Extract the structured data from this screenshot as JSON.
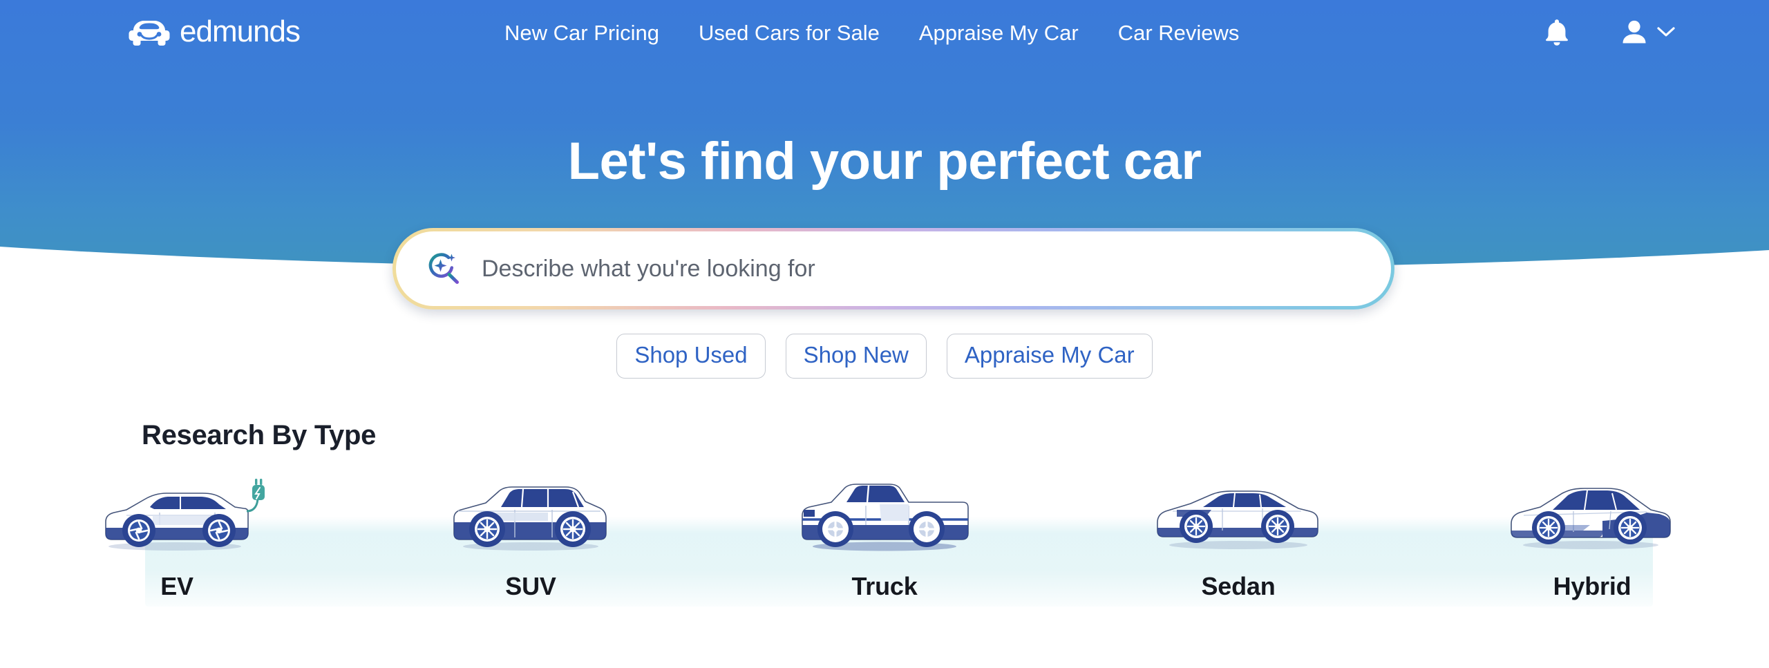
{
  "colors": {
    "hero_blue_top": "#3b7ada",
    "hero_blue_bottom": "#3f90c2",
    "nav_text": "#ffffff",
    "cta_text": "#2f63c4",
    "cta_border": "#c6cad2",
    "heading_text": "#1a1f2b",
    "car_navy": "#2b4492",
    "car_blue": "#3355a8",
    "band_mint": "#dbf2f5",
    "page_bg": "#ffffff"
  },
  "header": {
    "logo": {
      "icon": "car-smile-icon",
      "wordmark": "edmunds"
    },
    "nav_items": [
      {
        "label": "New Car Pricing"
      },
      {
        "label": "Used Cars for Sale"
      },
      {
        "label": "Appraise My Car"
      },
      {
        "label": "Car Reviews"
      }
    ],
    "notifications_icon": "bell-icon",
    "account_icon": "person-icon",
    "account_chevron_icon": "chevron-down-icon"
  },
  "hero": {
    "headline": "Let's find your perfect car",
    "search": {
      "icon": "ai-sparkle-search-icon",
      "placeholder": "Describe what you're looking for",
      "value": ""
    },
    "cta_buttons": [
      {
        "label": "Shop Used"
      },
      {
        "label": "Shop New"
      },
      {
        "label": "Appraise My Car"
      }
    ]
  },
  "research": {
    "section_title": "Research By Type",
    "types": [
      {
        "label": "EV",
        "art": "ev-car-illustration"
      },
      {
        "label": "SUV",
        "art": "suv-car-illustration"
      },
      {
        "label": "Truck",
        "art": "truck-illustration"
      },
      {
        "label": "Sedan",
        "art": "sedan-illustration"
      },
      {
        "label": "Hybrid",
        "art": "hybrid-car-illustration"
      }
    ]
  }
}
